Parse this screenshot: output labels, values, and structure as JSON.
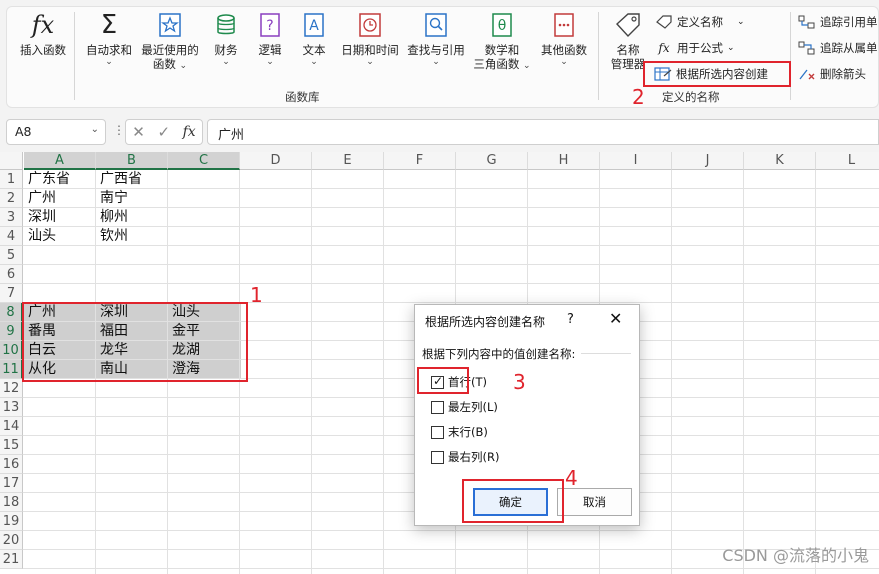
{
  "ribbon": {
    "group_label": "函数库",
    "defined_names_label": "定义的名称",
    "buttons": [
      {
        "label1": "插入函数",
        "label2": "",
        "chevron": false
      },
      {
        "label1": "自动求和",
        "label2": "",
        "chevron": true
      },
      {
        "label1": "最近使用的",
        "label2": "函数",
        "chevron": true
      },
      {
        "label1": "财务",
        "label2": "",
        "chevron": true
      },
      {
        "label1": "逻辑",
        "label2": "",
        "chevron": true
      },
      {
        "label1": "文本",
        "label2": "",
        "chevron": true
      },
      {
        "label1": "日期和时间",
        "label2": "",
        "chevron": true
      },
      {
        "label1": "查找与引用",
        "label2": "",
        "chevron": true
      },
      {
        "label1": "数学和",
        "label2": "三角函数",
        "chevron": true
      },
      {
        "label1": "其他函数",
        "label2": "",
        "chevron": true
      }
    ],
    "name_manager": {
      "label1": "名称",
      "label2": "管理器"
    },
    "define_name": "定义名称",
    "use_in_formula": "用于公式",
    "create_from_selection": "根据所选内容创建",
    "trace_precedents": "追踪引用单",
    "trace_dependents": "追踪从属单",
    "remove_arrows": "删除箭头"
  },
  "formula_bar": {
    "name_box": "A8",
    "fx": "fx",
    "value": "广州"
  },
  "sheet": {
    "columns": [
      "A",
      "B",
      "C",
      "D",
      "E",
      "F",
      "G",
      "H",
      "I",
      "J",
      "K",
      "L"
    ],
    "rows": [
      "1",
      "2",
      "3",
      "4",
      "5",
      "6",
      "7",
      "8",
      "9",
      "10",
      "11",
      "12",
      "13",
      "14",
      "15",
      "16",
      "17",
      "18",
      "19",
      "20",
      "21"
    ],
    "cells": [
      {
        "r": 1,
        "c": 0,
        "v": "广东省"
      },
      {
        "r": 1,
        "c": 1,
        "v": "广西省"
      },
      {
        "r": 2,
        "c": 0,
        "v": "广州"
      },
      {
        "r": 2,
        "c": 1,
        "v": "南宁"
      },
      {
        "r": 3,
        "c": 0,
        "v": "深圳"
      },
      {
        "r": 3,
        "c": 1,
        "v": "柳州"
      },
      {
        "r": 4,
        "c": 0,
        "v": "汕头"
      },
      {
        "r": 4,
        "c": 1,
        "v": "钦州"
      },
      {
        "r": 8,
        "c": 0,
        "v": "广州"
      },
      {
        "r": 8,
        "c": 1,
        "v": "深圳"
      },
      {
        "r": 8,
        "c": 2,
        "v": "汕头"
      },
      {
        "r": 9,
        "c": 0,
        "v": "番禺"
      },
      {
        "r": 9,
        "c": 1,
        "v": "福田"
      },
      {
        "r": 9,
        "c": 2,
        "v": "金平"
      },
      {
        "r": 10,
        "c": 0,
        "v": "白云"
      },
      {
        "r": 10,
        "c": 1,
        "v": "龙华"
      },
      {
        "r": 10,
        "c": 2,
        "v": "龙湖"
      },
      {
        "r": 11,
        "c": 0,
        "v": "从化"
      },
      {
        "r": 11,
        "c": 1,
        "v": "南山"
      },
      {
        "r": 11,
        "c": 2,
        "v": "澄海"
      }
    ]
  },
  "dialog": {
    "title": "根据所选内容创建名称",
    "help": "?",
    "close": "✕",
    "prompt": "根据下列内容中的值创建名称:",
    "options": [
      {
        "label": "首行(T)",
        "checked": true
      },
      {
        "label": "最左列(L)",
        "checked": false
      },
      {
        "label": "末行(B)",
        "checked": false
      },
      {
        "label": "最右列(R)",
        "checked": false
      }
    ],
    "ok": "确定",
    "cancel": "取消"
  },
  "annotations": [
    "1",
    "2",
    "3",
    "4"
  ],
  "watermark": "CSDN @流落的小鬼",
  "colors": {
    "accent": "#217346",
    "annotation": "#e0242d",
    "primary_button": "#2a6fd6"
  }
}
